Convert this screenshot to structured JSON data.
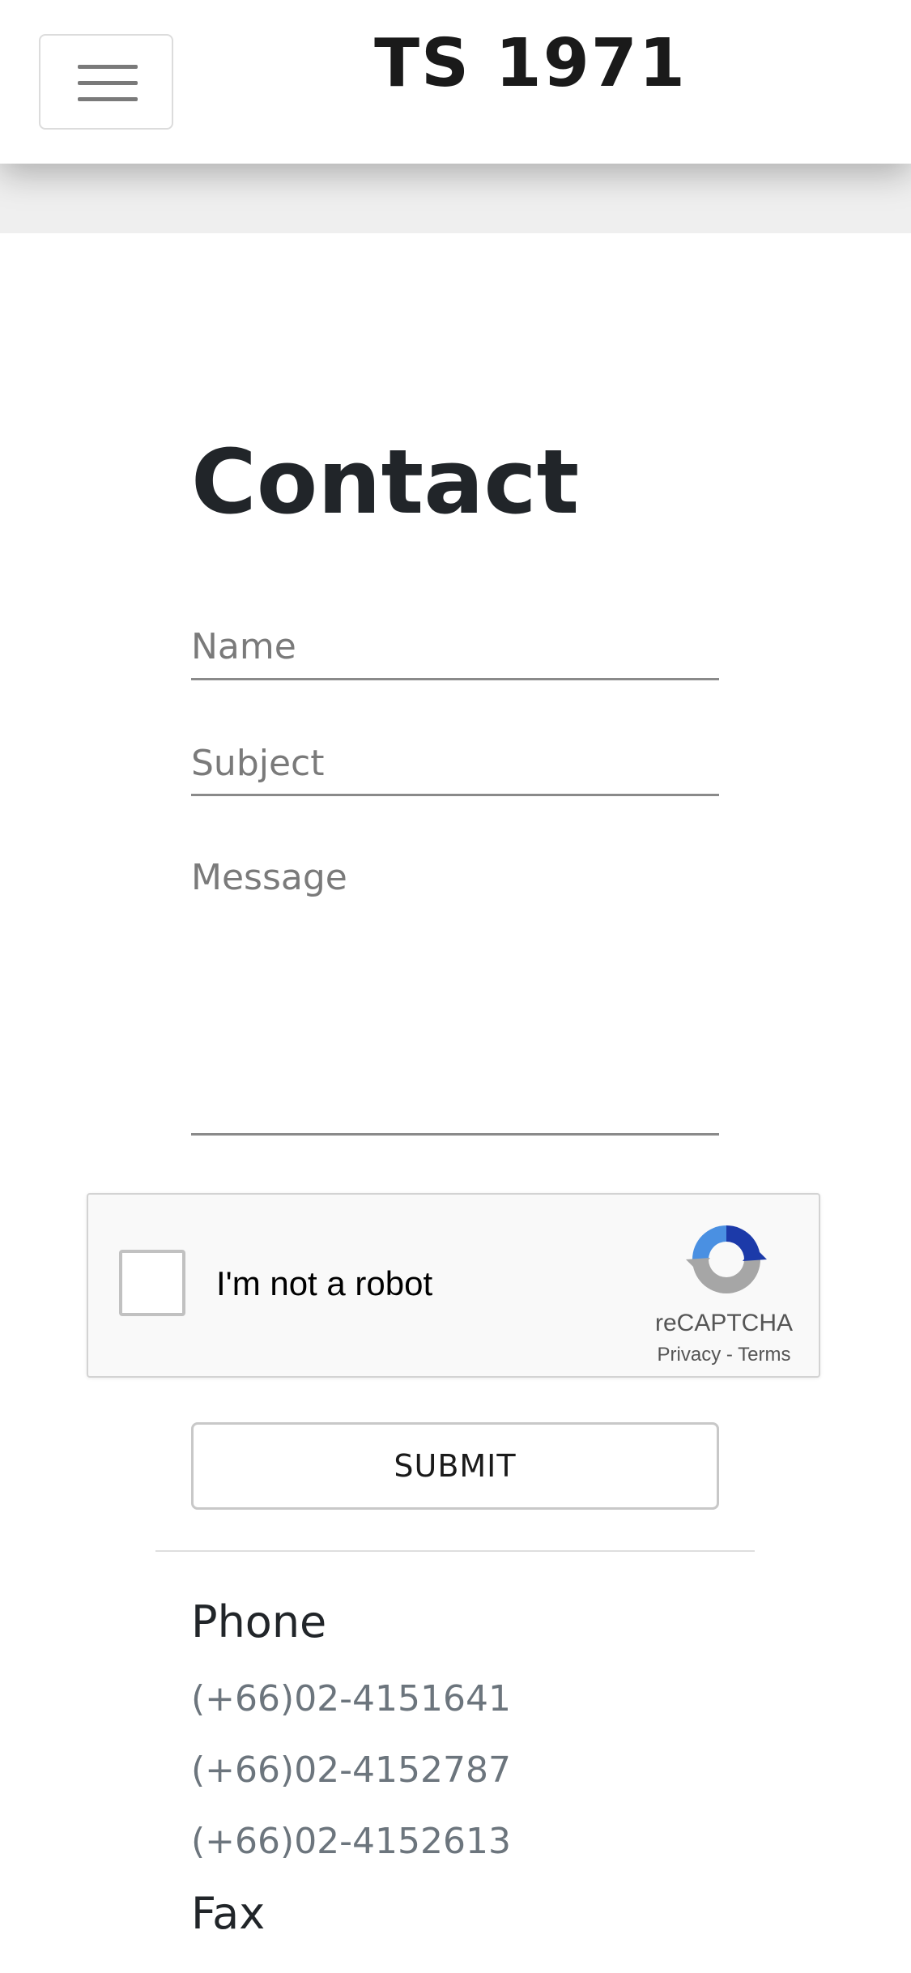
{
  "header": {
    "brand": "TS 1971",
    "menu_icon": "hamburger-icon"
  },
  "contact": {
    "title": "Contact",
    "name_placeholder": "Name",
    "subject_placeholder": "Subject",
    "message_placeholder": "Message",
    "submit_label": "SUBMIT"
  },
  "recaptcha": {
    "label": "I'm not a robot",
    "brand": "reCAPTCHA",
    "privacy": "Privacy",
    "separator": " - ",
    "terms": "Terms",
    "logo_icon": "recaptcha-logo-icon"
  },
  "info": {
    "phone_heading": "Phone",
    "phones": [
      "(+66)02-4151641",
      "(+66)02-4152787",
      "(+66)02-4152613"
    ],
    "fax_heading": "Fax"
  },
  "colors": {
    "text_dark": "#212529",
    "text_muted": "#6c757d",
    "recaptcha_blue": "#1c3aa9",
    "recaptcha_lightblue": "#4a90e2",
    "recaptcha_grey": "#a6a6a6"
  }
}
